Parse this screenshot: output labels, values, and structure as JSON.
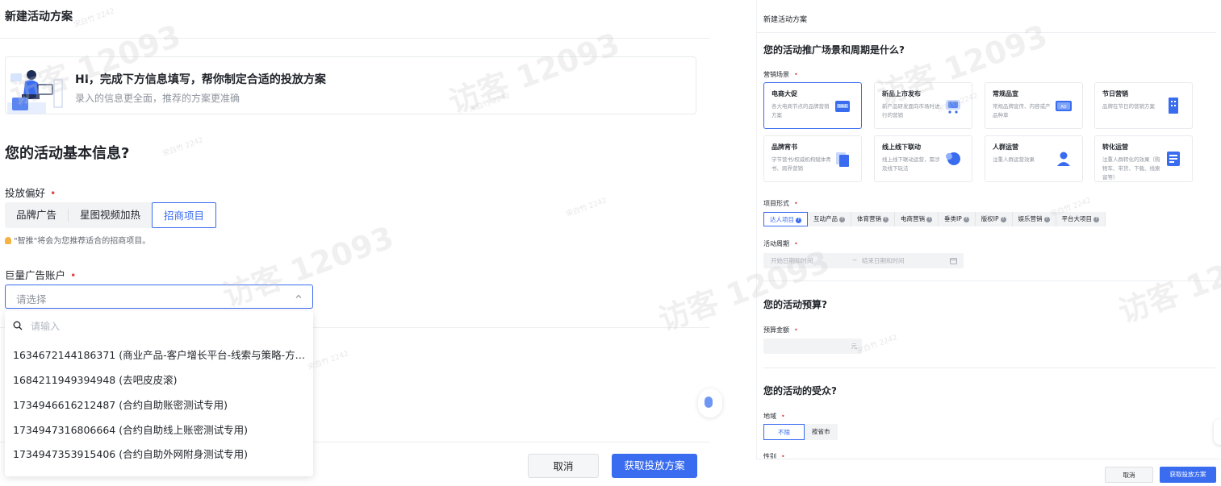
{
  "left": {
    "page_title": "新建活动方案",
    "banner": {
      "title": "HI，完成下方信息填写，帮你制定合适的投放方案",
      "subtitle": "录入的信息更全面，推荐的方案更准确"
    },
    "section_title": "您的活动基本信息?",
    "preference": {
      "label": "投放偏好",
      "required_mark": "•",
      "options": [
        "品牌广告",
        "星图视频加热",
        "招商项目"
      ],
      "selected": "招商项目",
      "hint": "\"智推\"将会为您推荐适合的招商项目。"
    },
    "account": {
      "label": "巨量广告账户",
      "required_mark": "•",
      "placeholder": "请选择",
      "search_placeholder": "请输入",
      "items": [
        "1634672144186371 (商业产品-客户增长平台-线索与策略-方霞...",
        "1684211949394948 (去吧皮皮滚)",
        "1734946616212487 (合约自助账密测试专用)",
        "1734947316806664 (合约自助线上账密测试专用)",
        "1734947353915406 (合约自助外网附身测试专用)"
      ]
    },
    "footer": {
      "cancel": "取消",
      "submit": "获取投放方案"
    }
  },
  "right": {
    "page_title": "新建活动方案",
    "q1": "您的活动推广场景和周期是什么?",
    "scene_label": "营销场景",
    "required_mark": "•",
    "scenes": [
      {
        "title": "电商大促",
        "desc": "各大电商节点的品牌营销方案",
        "icon": "sale-bag-icon"
      },
      {
        "title": "新品上市发布",
        "desc": "新产品研发面向市场时进行的营销",
        "icon": "new-cart-icon"
      },
      {
        "title": "常规品宣",
        "desc": "常规品牌宣传、内容或产品种草",
        "icon": "ad-screen-icon"
      },
      {
        "title": "节日营销",
        "desc": "品牌在节日的营销方案",
        "icon": "building-icon"
      },
      {
        "title": "品牌宵书",
        "desc": "学节营书/权威机构赋体青书、跨界营销",
        "icon": "doc-stack-icon"
      },
      {
        "title": "线上线下联动",
        "desc": "线上线下联动运营，需涉及线下玩法",
        "icon": "chat-bubble-icon"
      },
      {
        "title": "人群运营",
        "desc": "注重人群运营效果",
        "icon": "person-icon"
      },
      {
        "title": "转化运营",
        "desc": "注重人群转化的效果（购物车、带货、下载、线索留等）",
        "icon": "form-icon"
      }
    ],
    "form_label": "项目形式",
    "forms": [
      "达人项目",
      "互动产品",
      "体育营销",
      "电商营销",
      "垂类IP",
      "版权IP",
      "娱乐营销",
      "平台大项目"
    ],
    "period_label": "活动周期",
    "period": {
      "start": "开始日期和时间",
      "sep": "~",
      "end": "结束日期和时间"
    },
    "q2": "您的活动预算?",
    "budget_label": "预算金额",
    "budget_unit": "元",
    "q3": "您的活动的受众?",
    "region_label": "地域",
    "region_options": [
      "不限",
      "按省市"
    ],
    "gender_label": "性别",
    "footer": {
      "cancel": "取消",
      "submit": "获取投放方案"
    }
  },
  "watermarks": {
    "big": "访客 12093",
    "small": "宋白竹 2242"
  },
  "colors": {
    "primary": "#3a6cf0",
    "required": "#e54545",
    "muted": "#8f959e"
  }
}
